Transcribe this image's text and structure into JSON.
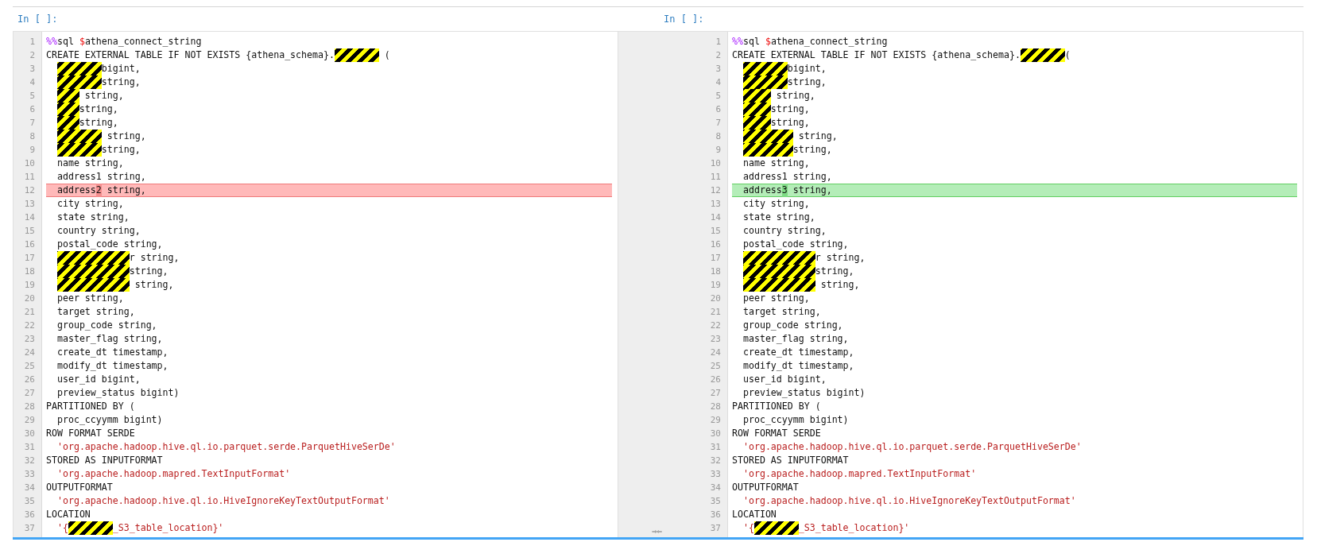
{
  "cells": [
    {
      "prompt": "In [ ]:",
      "kind": "old",
      "lines": [
        {
          "number": "1",
          "changed": false,
          "segments": [
            {
              "kind": "magic",
              "text": "%%"
            },
            {
              "kind": "plain",
              "text": "sql "
            },
            {
              "kind": "variable",
              "text": "$"
            },
            {
              "kind": "plain",
              "text": "athena_connect_string"
            }
          ]
        },
        {
          "number": "2",
          "changed": false,
          "segments": [
            {
              "kind": "plain",
              "text": "CREATE EXTERNAL TABLE IF NOT EXISTS {athena_schema}."
            },
            {
              "kind": "redacted"
            },
            {
              "kind": "plain",
              "text": " ("
            }
          ]
        },
        {
          "number": "3",
          "changed": false,
          "indented": true,
          "segments": [
            {
              "kind": "redacted"
            },
            {
              "kind": "plain",
              "text": "bigint,"
            }
          ]
        },
        {
          "number": "4",
          "changed": false,
          "indented": true,
          "segments": [
            {
              "kind": "redacted"
            },
            {
              "kind": "plain",
              "text": "string,"
            }
          ]
        },
        {
          "number": "5",
          "changed": false,
          "indented": true,
          "segments": [
            {
              "kind": "redacted"
            },
            {
              "kind": "plain",
              "text": " string,"
            }
          ]
        },
        {
          "number": "6",
          "changed": false,
          "indented": true,
          "segments": [
            {
              "kind": "redacted"
            },
            {
              "kind": "plain",
              "text": "string,"
            }
          ]
        },
        {
          "number": "7",
          "changed": false,
          "indented": true,
          "segments": [
            {
              "kind": "redacted"
            },
            {
              "kind": "plain",
              "text": "string,"
            }
          ]
        },
        {
          "number": "8",
          "changed": false,
          "indented": true,
          "segments": [
            {
              "kind": "redacted"
            },
            {
              "kind": "plain",
              "text": " string,"
            }
          ]
        },
        {
          "number": "9",
          "changed": false,
          "indented": true,
          "segments": [
            {
              "kind": "redacted"
            },
            {
              "kind": "plain",
              "text": "string,"
            }
          ]
        },
        {
          "number": "10",
          "changed": false,
          "segments": [
            {
              "kind": "plain",
              "text": "  name string,"
            }
          ]
        },
        {
          "number": "11",
          "changed": false,
          "segments": [
            {
              "kind": "plain",
              "text": "  address1 string,"
            }
          ]
        },
        {
          "number": "12",
          "changed": true,
          "segments": [
            {
              "kind": "plain",
              "text": "  address"
            },
            {
              "kind": "diff",
              "text": "2"
            },
            {
              "kind": "plain",
              "text": " string,"
            }
          ]
        },
        {
          "number": "13",
          "changed": false,
          "segments": [
            {
              "kind": "plain",
              "text": "  city string,"
            }
          ]
        },
        {
          "number": "14",
          "changed": false,
          "segments": [
            {
              "kind": "plain",
              "text": "  state string,"
            }
          ]
        },
        {
          "number": "15",
          "changed": false,
          "segments": [
            {
              "kind": "plain",
              "text": "  country string,"
            }
          ]
        },
        {
          "number": "16",
          "changed": false,
          "segments": [
            {
              "kind": "plain",
              "text": "  postal_code string,"
            }
          ]
        },
        {
          "number": "17",
          "changed": false,
          "indented": true,
          "segments": [
            {
              "kind": "redacted"
            },
            {
              "kind": "plain",
              "text": "r string,"
            }
          ]
        },
        {
          "number": "18",
          "changed": false,
          "indented": true,
          "segments": [
            {
              "kind": "redacted"
            },
            {
              "kind": "plain",
              "text": "string,"
            }
          ]
        },
        {
          "number": "19",
          "changed": false,
          "indented": true,
          "segments": [
            {
              "kind": "redacted"
            },
            {
              "kind": "plain",
              "text": " string,"
            }
          ]
        },
        {
          "number": "20",
          "changed": false,
          "segments": [
            {
              "kind": "plain",
              "text": "  peer string,"
            }
          ]
        },
        {
          "number": "21",
          "changed": false,
          "segments": [
            {
              "kind": "plain",
              "text": "  target string,"
            }
          ]
        },
        {
          "number": "22",
          "changed": false,
          "segments": [
            {
              "kind": "plain",
              "text": "  group_code string,"
            }
          ]
        },
        {
          "number": "23",
          "changed": false,
          "segments": [
            {
              "kind": "plain",
              "text": "  master_flag string,"
            }
          ]
        },
        {
          "number": "24",
          "changed": false,
          "segments": [
            {
              "kind": "plain",
              "text": "  create_dt timestamp,"
            }
          ]
        },
        {
          "number": "25",
          "changed": false,
          "segments": [
            {
              "kind": "plain",
              "text": "  modify_dt timestamp,"
            }
          ]
        },
        {
          "number": "26",
          "changed": false,
          "segments": [
            {
              "kind": "plain",
              "text": "  user_id bigint,"
            }
          ]
        },
        {
          "number": "27",
          "changed": false,
          "segments": [
            {
              "kind": "plain",
              "text": "  preview_status bigint)"
            }
          ]
        },
        {
          "number": "28",
          "changed": false,
          "segments": [
            {
              "kind": "plain",
              "text": "PARTITIONED BY ("
            }
          ]
        },
        {
          "number": "29",
          "changed": false,
          "segments": [
            {
              "kind": "plain",
              "text": "  proc_ccyymm bigint)"
            }
          ]
        },
        {
          "number": "30",
          "changed": false,
          "segments": [
            {
              "kind": "plain",
              "text": "ROW FORMAT SERDE"
            }
          ]
        },
        {
          "number": "31",
          "changed": false,
          "segments": [
            {
              "kind": "string",
              "text": "  'org.apache.hadoop.hive.ql.io.parquet.serde.ParquetHiveSerDe'"
            }
          ]
        },
        {
          "number": "32",
          "changed": false,
          "segments": [
            {
              "kind": "plain",
              "text": "STORED AS INPUTFORMAT"
            }
          ]
        },
        {
          "number": "33",
          "changed": false,
          "segments": [
            {
              "kind": "string",
              "text": "  'org.apache.hadoop.mapred.TextInputFormat'"
            }
          ]
        },
        {
          "number": "34",
          "changed": false,
          "segments": [
            {
              "kind": "plain",
              "text": "OUTPUTFORMAT"
            }
          ]
        },
        {
          "number": "35",
          "changed": false,
          "segments": [
            {
              "kind": "string",
              "text": "  'org.apache.hadoop.hive.ql.io.HiveIgnoreKeyTextOutputFormat'"
            }
          ]
        },
        {
          "number": "36",
          "changed": false,
          "segments": [
            {
              "kind": "plain",
              "text": "LOCATION"
            }
          ]
        },
        {
          "number": "37",
          "changed": false,
          "segments": [
            {
              "kind": "string",
              "text": "  '{"
            },
            {
              "kind": "redacted"
            },
            {
              "kind": "string",
              "text": "_S3_table_location}'"
            }
          ]
        }
      ]
    },
    {
      "prompt": "In [ ]:",
      "kind": "new",
      "lines": [
        {
          "number": "1",
          "changed": false,
          "segments": [
            {
              "kind": "magic",
              "text": "%%"
            },
            {
              "kind": "plain",
              "text": "sql "
            },
            {
              "kind": "variable",
              "text": "$"
            },
            {
              "kind": "plain",
              "text": "athena_connect_string"
            }
          ]
        },
        {
          "number": "2",
          "changed": false,
          "segments": [
            {
              "kind": "plain",
              "text": "CREATE EXTERNAL TABLE IF NOT EXISTS {athena_schema}."
            },
            {
              "kind": "redacted"
            },
            {
              "kind": "plain",
              "text": "("
            }
          ]
        },
        {
          "number": "3",
          "changed": false,
          "indented": true,
          "segments": [
            {
              "kind": "redacted"
            },
            {
              "kind": "plain",
              "text": "bigint,"
            }
          ]
        },
        {
          "number": "4",
          "changed": false,
          "indented": true,
          "segments": [
            {
              "kind": "redacted"
            },
            {
              "kind": "plain",
              "text": "string,"
            }
          ]
        },
        {
          "number": "5",
          "changed": false,
          "indented": true,
          "segments": [
            {
              "kind": "redacted"
            },
            {
              "kind": "plain",
              "text": " string,"
            }
          ]
        },
        {
          "number": "6",
          "changed": false,
          "indented": true,
          "segments": [
            {
              "kind": "redacted"
            },
            {
              "kind": "plain",
              "text": "string,"
            }
          ]
        },
        {
          "number": "7",
          "changed": false,
          "indented": true,
          "segments": [
            {
              "kind": "redacted"
            },
            {
              "kind": "plain",
              "text": "string,"
            }
          ]
        },
        {
          "number": "8",
          "changed": false,
          "indented": true,
          "segments": [
            {
              "kind": "redacted"
            },
            {
              "kind": "plain",
              "text": " string,"
            }
          ]
        },
        {
          "number": "9",
          "changed": false,
          "indented": true,
          "segments": [
            {
              "kind": "redacted"
            },
            {
              "kind": "plain",
              "text": "string,"
            }
          ]
        },
        {
          "number": "10",
          "changed": false,
          "segments": [
            {
              "kind": "plain",
              "text": "  name string,"
            }
          ]
        },
        {
          "number": "11",
          "changed": false,
          "segments": [
            {
              "kind": "plain",
              "text": "  address1 string,"
            }
          ]
        },
        {
          "number": "12",
          "changed": true,
          "segments": [
            {
              "kind": "plain",
              "text": "  address"
            },
            {
              "kind": "diff",
              "text": "3"
            },
            {
              "kind": "plain",
              "text": " string,"
            }
          ]
        },
        {
          "number": "13",
          "changed": false,
          "segments": [
            {
              "kind": "plain",
              "text": "  city string,"
            }
          ]
        },
        {
          "number": "14",
          "changed": false,
          "segments": [
            {
              "kind": "plain",
              "text": "  state string,"
            }
          ]
        },
        {
          "number": "15",
          "changed": false,
          "segments": [
            {
              "kind": "plain",
              "text": "  country string,"
            }
          ]
        },
        {
          "number": "16",
          "changed": false,
          "segments": [
            {
              "kind": "plain",
              "text": "  postal_code string,"
            }
          ]
        },
        {
          "number": "17",
          "changed": false,
          "indented": true,
          "segments": [
            {
              "kind": "redacted"
            },
            {
              "kind": "plain",
              "text": "r string,"
            }
          ]
        },
        {
          "number": "18",
          "changed": false,
          "indented": true,
          "segments": [
            {
              "kind": "redacted"
            },
            {
              "kind": "plain",
              "text": "string,"
            }
          ]
        },
        {
          "number": "19",
          "changed": false,
          "indented": true,
          "segments": [
            {
              "kind": "redacted"
            },
            {
              "kind": "plain",
              "text": " string,"
            }
          ]
        },
        {
          "number": "20",
          "changed": false,
          "segments": [
            {
              "kind": "plain",
              "text": "  peer string,"
            }
          ]
        },
        {
          "number": "21",
          "changed": false,
          "segments": [
            {
              "kind": "plain",
              "text": "  target string,"
            }
          ]
        },
        {
          "number": "22",
          "changed": false,
          "segments": [
            {
              "kind": "plain",
              "text": "  group_code string,"
            }
          ]
        },
        {
          "number": "23",
          "changed": false,
          "segments": [
            {
              "kind": "plain",
              "text": "  master_flag string,"
            }
          ]
        },
        {
          "number": "24",
          "changed": false,
          "segments": [
            {
              "kind": "plain",
              "text": "  create_dt timestamp,"
            }
          ]
        },
        {
          "number": "25",
          "changed": false,
          "segments": [
            {
              "kind": "plain",
              "text": "  modify_dt timestamp,"
            }
          ]
        },
        {
          "number": "26",
          "changed": false,
          "segments": [
            {
              "kind": "plain",
              "text": "  user_id bigint,"
            }
          ]
        },
        {
          "number": "27",
          "changed": false,
          "segments": [
            {
              "kind": "plain",
              "text": "  preview_status bigint)"
            }
          ]
        },
        {
          "number": "28",
          "changed": false,
          "segments": [
            {
              "kind": "plain",
              "text": "PARTITIONED BY ("
            }
          ]
        },
        {
          "number": "29",
          "changed": false,
          "segments": [
            {
              "kind": "plain",
              "text": "  proc_ccyymm bigint)"
            }
          ]
        },
        {
          "number": "30",
          "changed": false,
          "segments": [
            {
              "kind": "plain",
              "text": "ROW FORMAT SERDE"
            }
          ]
        },
        {
          "number": "31",
          "changed": false,
          "segments": [
            {
              "kind": "string",
              "text": "  'org.apache.hadoop.hive.ql.io.parquet.serde.ParquetHiveSerDe'"
            }
          ]
        },
        {
          "number": "32",
          "changed": false,
          "segments": [
            {
              "kind": "plain",
              "text": "STORED AS INPUTFORMAT"
            }
          ]
        },
        {
          "number": "33",
          "changed": false,
          "segments": [
            {
              "kind": "string",
              "text": "  'org.apache.hadoop.mapred.TextInputFormat'"
            }
          ]
        },
        {
          "number": "34",
          "changed": false,
          "segments": [
            {
              "kind": "plain",
              "text": "OUTPUTFORMAT"
            }
          ]
        },
        {
          "number": "35",
          "changed": false,
          "segments": [
            {
              "kind": "string",
              "text": "  'org.apache.hadoop.hive.ql.io.HiveIgnoreKeyTextOutputFormat'"
            }
          ]
        },
        {
          "number": "36",
          "changed": false,
          "segments": [
            {
              "kind": "plain",
              "text": "LOCATION"
            }
          ]
        },
        {
          "number": "37",
          "changed": false,
          "segments": [
            {
              "kind": "string",
              "text": "  '{"
            },
            {
              "kind": "redacted"
            },
            {
              "kind": "string",
              "text": "_S3_table_location}'"
            }
          ]
        }
      ]
    }
  ],
  "merge_marker": "⇒⇐"
}
